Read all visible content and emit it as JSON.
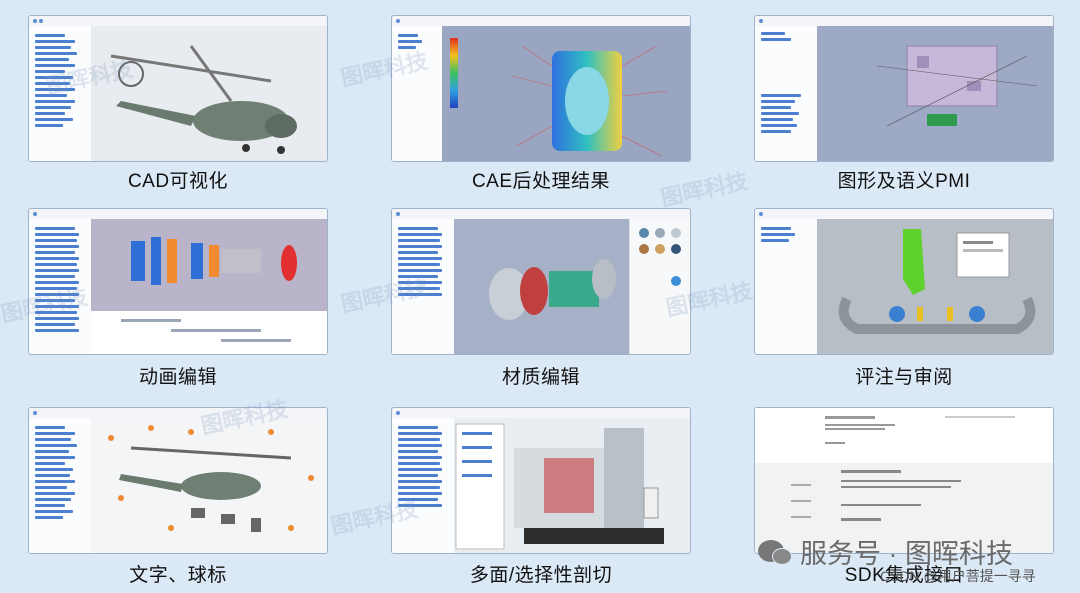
{
  "features": [
    {
      "caption": "CAD可视化",
      "visual": "helicopter-model",
      "viewport_bg": "#e8ebef"
    },
    {
      "caption": "CAE后处理结果",
      "visual": "cae-field-plot",
      "viewport_bg": "#9aa6c1"
    },
    {
      "caption": "图形及语义PMI",
      "visual": "pmi-part",
      "viewport_bg": "#9ea9c5"
    },
    {
      "caption": "动画编辑",
      "visual": "engine-exploded",
      "viewport_bg": "#eef1f4"
    },
    {
      "caption": "材质编辑",
      "visual": "turbine-material",
      "viewport_bg": "#a6b1c8"
    },
    {
      "caption": "评注与审阅",
      "visual": "pipe-assembly-review",
      "viewport_bg": "#b8bec6"
    },
    {
      "caption": "文字、球标",
      "visual": "helicopter-balloons",
      "viewport_bg": "#f4f5f7"
    },
    {
      "caption": "多面/选择性剖切",
      "visual": "machine-section",
      "viewport_bg": "#e9eef3"
    },
    {
      "caption": "SDK集成接口",
      "visual": "sdk-docs",
      "viewport_bg": "#ffffff"
    }
  ],
  "watermark": "图晖科技",
  "footer": {
    "account": "服务号 · 图晖科技",
    "csdn": "CSDN @用户菩提一寻寻"
  },
  "colors": {
    "background": "#dbe9f6",
    "tree_accent": "#4d7fd1"
  }
}
